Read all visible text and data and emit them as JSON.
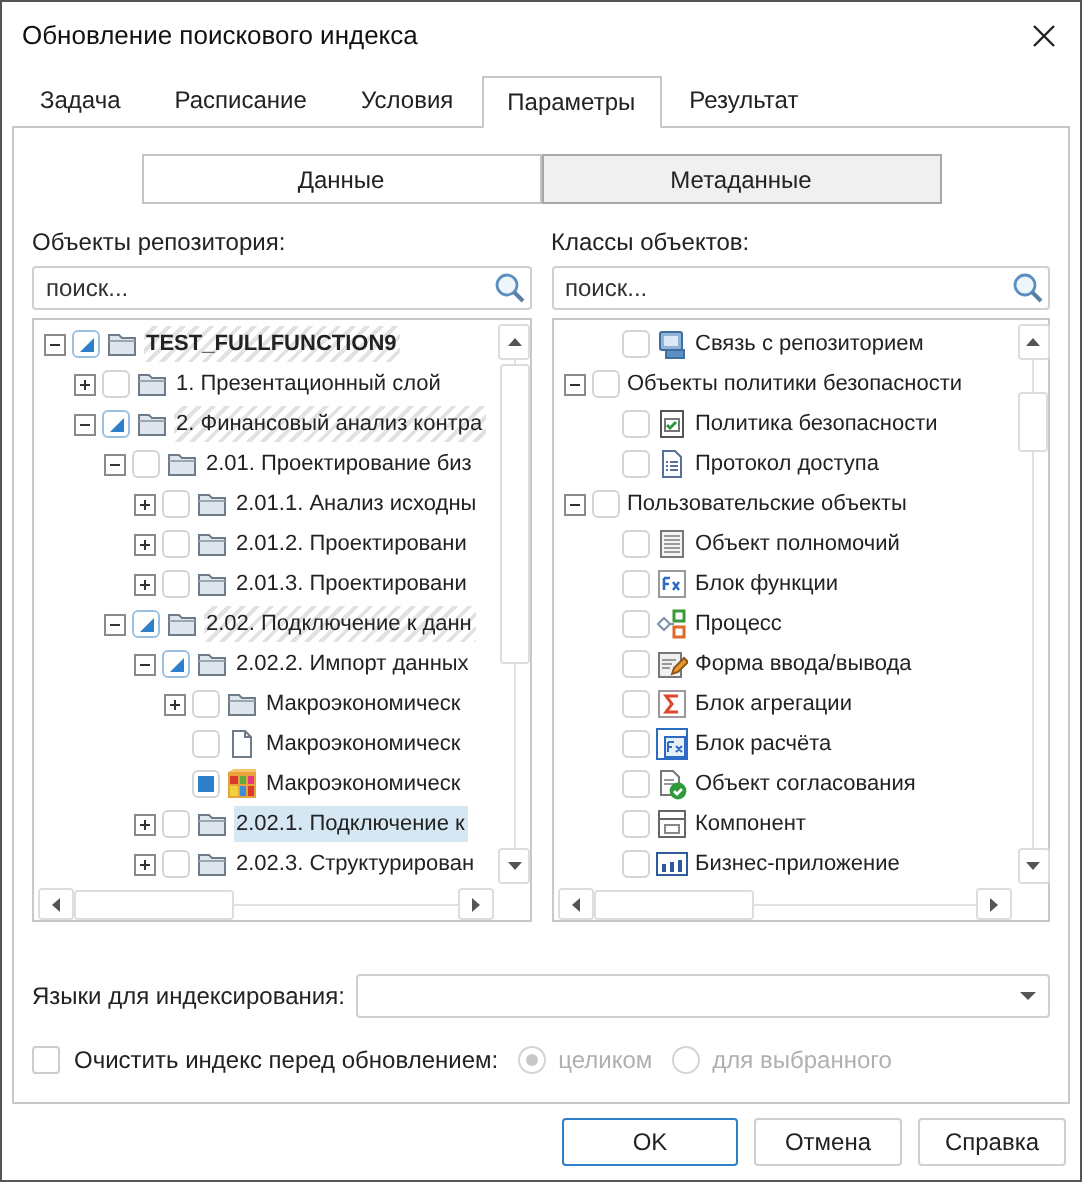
{
  "window": {
    "title": "Обновление поискового индекса"
  },
  "tabs": [
    {
      "label": "Задача",
      "selected": false
    },
    {
      "label": "Расписание",
      "selected": false
    },
    {
      "label": "Условия",
      "selected": false
    },
    {
      "label": "Параметры",
      "selected": true
    },
    {
      "label": "Результат",
      "selected": false
    }
  ],
  "mode_switch": [
    {
      "label": "Данные",
      "selected": false
    },
    {
      "label": "Метаданные",
      "selected": true
    }
  ],
  "panels": [
    {
      "label": "Объекты репозитория:",
      "search": {
        "placeholder": "поиск..."
      },
      "items": [
        {
          "label": "TEST_FULLFUNCTION9",
          "kind": "folder",
          "expanded": true,
          "indeterminate": true,
          "bold": true,
          "hatched": true,
          "selected": false,
          "children": [
            {
              "label": "1. Презентационный слой",
              "kind": "folder",
              "expanded": false,
              "checked": false,
              "indeterminate": false,
              "bold": false,
              "hatched": false,
              "selected": false
            },
            {
              "label": "2. Финансовый анализ контра",
              "kind": "folder",
              "expanded": true,
              "indeterminate": true,
              "bold": false,
              "hatched": true,
              "selected": false,
              "children": [
                {
                  "label": "2.01. Проектирование биз",
                  "kind": "folder",
                  "expanded": true,
                  "checked": false,
                  "indeterminate": false,
                  "bold": false,
                  "hatched": false,
                  "selected": false,
                  "children": [
                    {
                      "label": "2.01.1. Анализ исходны",
                      "kind": "folder",
                      "expanded": false,
                      "checked": false,
                      "indeterminate": false,
                      "bold": false,
                      "hatched": false,
                      "selected": false
                    },
                    {
                      "label": "2.01.2. Проектировани",
                      "kind": "folder",
                      "expanded": false,
                      "checked": false,
                      "indeterminate": false,
                      "bold": false,
                      "hatched": false,
                      "selected": false
                    },
                    {
                      "label": "2.01.3. Проектировани",
                      "kind": "folder",
                      "expanded": false,
                      "checked": false,
                      "indeterminate": false,
                      "bold": false,
                      "hatched": false,
                      "selected": false
                    }
                  ]
                },
                {
                  "label": "2.02. Подключение к данн",
                  "kind": "folder",
                  "expanded": true,
                  "indeterminate": true,
                  "bold": false,
                  "hatched": true,
                  "selected": false,
                  "children": [
                    {
                      "label": "2.02.2. Импорт данных",
                      "kind": "folder",
                      "expanded": true,
                      "indeterminate": true,
                      "bold": false,
                      "hatched": false,
                      "selected": false,
                      "children": [
                        {
                          "label": "Макроэкономическ",
                          "kind": "folder",
                          "expanded": false,
                          "checked": false,
                          "indeterminate": false,
                          "bold": false,
                          "hatched": false,
                          "selected": false
                        },
                        {
                          "label": "Макроэкономическ",
                          "kind": "file",
                          "checked": false,
                          "indeterminate": false,
                          "bold": false,
                          "hatched": false,
                          "selected": false
                        },
                        {
                          "label": "Макроэкономическ",
                          "kind": "cube",
                          "checked": true,
                          "indeterminate": false,
                          "bold": false,
                          "hatched": false,
                          "selected": false
                        }
                      ]
                    },
                    {
                      "label": "2.02.1. Подключение к",
                      "kind": "folder",
                      "expanded": false,
                      "checked": false,
                      "indeterminate": false,
                      "bold": false,
                      "hatched": false,
                      "selected": true
                    },
                    {
                      "label": "2.02.3. Структурирован",
                      "kind": "folder",
                      "expanded": false,
                      "checked": false,
                      "indeterminate": false,
                      "bold": false,
                      "hatched": false,
                      "selected": false
                    }
                  ]
                }
              ]
            }
          ]
        }
      ]
    },
    {
      "label": "Классы объектов:",
      "search": {
        "placeholder": "поиск..."
      },
      "items": [
        {
          "children": [
            {
              "label": "Связь с репозиторием",
              "kind": "repository",
              "checked": false,
              "indeterminate": false,
              "bold": false,
              "hatched": false,
              "selected": false
            }
          ]
        },
        {
          "label": "Объекты политики безопасности",
          "expanded": true,
          "checked": false,
          "indeterminate": false,
          "bold": false,
          "hatched": false,
          "selected": false,
          "children": [
            {
              "label": "Политика безопасности",
              "kind": "policy",
              "checked": false,
              "indeterminate": false,
              "bold": false,
              "hatched": false,
              "selected": false
            },
            {
              "label": "Протокол доступа",
              "kind": "protocol",
              "checked": false,
              "indeterminate": false,
              "bold": false,
              "hatched": false,
              "selected": false
            }
          ]
        },
        {
          "label": "Пользовательские объекты",
          "expanded": true,
          "checked": false,
          "indeterminate": false,
          "bold": false,
          "hatched": false,
          "selected": false,
          "children": [
            {
              "label": "Объект полномочий",
              "kind": "doc",
              "checked": false,
              "indeterminate": false,
              "bold": false,
              "hatched": false,
              "selected": false
            },
            {
              "label": "Блок функции",
              "kind": "function",
              "checked": false,
              "indeterminate": false,
              "bold": false,
              "hatched": false,
              "selected": false
            },
            {
              "label": "Процесс",
              "kind": "process",
              "checked": false,
              "indeterminate": false,
              "bold": false,
              "hatched": false,
              "selected": false
            },
            {
              "label": "Форма ввода/вывода",
              "kind": "form",
              "checked": false,
              "indeterminate": false,
              "bold": false,
              "hatched": false,
              "selected": false
            },
            {
              "label": "Блок агрегации",
              "kind": "sigma",
              "checked": false,
              "indeterminate": false,
              "bold": false,
              "hatched": false,
              "selected": false
            },
            {
              "label": "Блок расчёта",
              "kind": "calc",
              "checked": false,
              "indeterminate": false,
              "bold": false,
              "hatched": false,
              "selected": false
            },
            {
              "label": "Объект согласования",
              "kind": "approval",
              "checked": false,
              "indeterminate": false,
              "bold": false,
              "hatched": false,
              "selected": false
            },
            {
              "label": "Компонент",
              "kind": "component",
              "checked": false,
              "indeterminate": false,
              "bold": false,
              "hatched": false,
              "selected": false
            },
            {
              "label": "Бизнес-приложение",
              "kind": "app",
              "checked": false,
              "indeterminate": false,
              "bold": false,
              "hatched": false,
              "selected": false
            }
          ]
        }
      ]
    }
  ],
  "languages": {
    "label": "Языки для индексирования:"
  },
  "clear_index": {
    "label": "Очистить индекс перед обновлением:",
    "checked": false,
    "options": [
      {
        "label": "целиком",
        "selected": true,
        "disabled": true
      },
      {
        "label": "для выбранного",
        "selected": false,
        "disabled": true
      }
    ]
  },
  "buttons": [
    {
      "label": "OK",
      "default": true
    },
    {
      "label": "Отмена",
      "default": false
    },
    {
      "label": "Справка",
      "default": false
    }
  ]
}
